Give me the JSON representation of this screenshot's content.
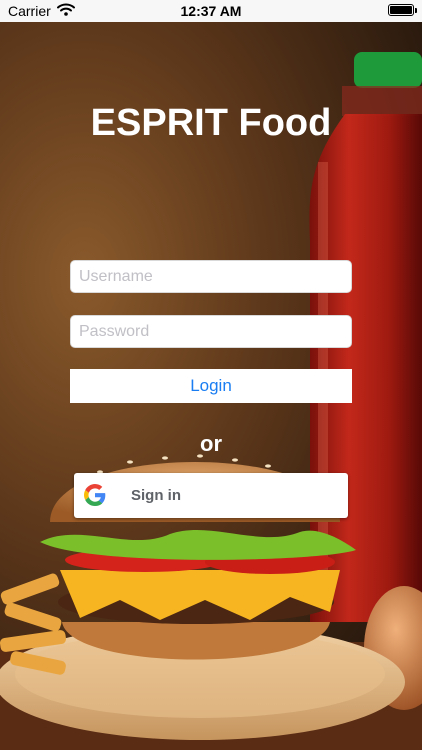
{
  "status_bar": {
    "carrier": "Carrier",
    "time": "12:37 AM"
  },
  "app": {
    "title": "ESPRIT Food"
  },
  "login_form": {
    "username_placeholder": "Username",
    "password_placeholder": "Password",
    "login_label": "Login",
    "or_label": "or",
    "google_sign_in_label": "Sign in"
  },
  "colors": {
    "accent": "#1a7ef2",
    "title": "#ffffff",
    "google_text": "#5f6368"
  },
  "icons": [
    "wifi-icon",
    "battery-icon",
    "google-g-icon"
  ]
}
